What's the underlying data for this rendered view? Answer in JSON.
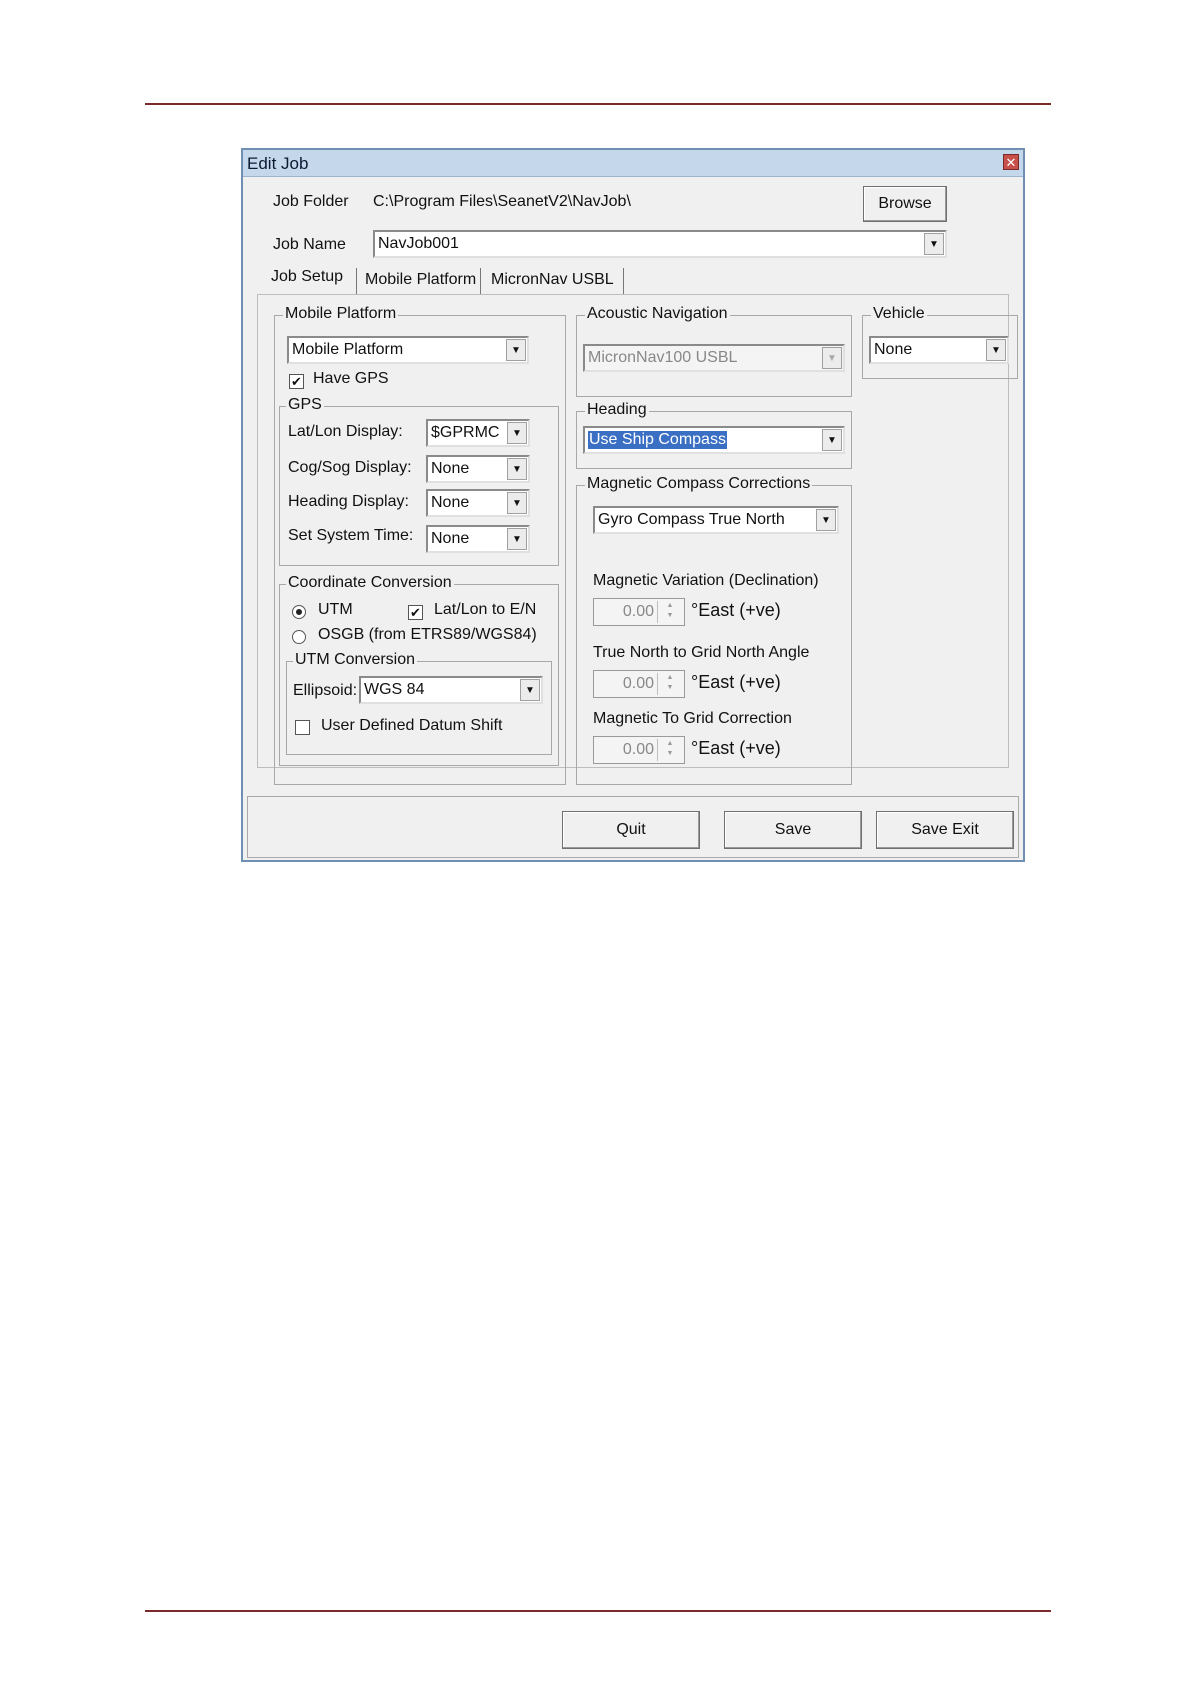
{
  "dialog": {
    "title": "Edit Job",
    "close_glyph": "✕"
  },
  "job": {
    "folder_label": "Job Folder",
    "folder_value": "C:\\Program Files\\SeanetV2\\NavJob\\",
    "browse_label": "Browse",
    "name_label": "Job Name",
    "name_value": "NavJob001"
  },
  "tabs": [
    {
      "label": "Job Setup",
      "selected": true
    },
    {
      "label": "Mobile Platform",
      "selected": false
    },
    {
      "label": "MicronNav USBL",
      "selected": false
    }
  ],
  "mobile_platform": {
    "caption": "Mobile Platform",
    "selected": "Mobile Platform",
    "have_gps_label": "Have GPS",
    "have_gps_checked": true
  },
  "gps": {
    "caption": "GPS",
    "rows": [
      {
        "label": "Lat/Lon Display:",
        "value": "$GPRMC"
      },
      {
        "label": "Cog/Sog Display:",
        "value": "None"
      },
      {
        "label": "Heading Display:",
        "value": "None"
      },
      {
        "label": "Set System Time:",
        "value": "None"
      }
    ]
  },
  "coord": {
    "caption": "Coordinate Conversion",
    "utm_label": "UTM",
    "utm_selected": true,
    "latlon_label": "Lat/Lon to E/N",
    "latlon_checked": true,
    "osgb_label": "OSGB (from ETRS89/WGS84)",
    "osgb_selected": false
  },
  "utm_conv": {
    "caption": "UTM Conversion",
    "ellipsoid_label": "Ellipsoid:",
    "ellipsoid_value": "WGS 84",
    "datum_label": "User Defined Datum Shift",
    "datum_checked": false
  },
  "acoustic": {
    "caption": "Acoustic Navigation",
    "value": "MicronNav100 USBL"
  },
  "heading": {
    "caption": "Heading",
    "value": "Use Ship Compass"
  },
  "magnetic": {
    "caption": "Magnetic Compass Corrections",
    "mode": "Gyro Compass True North",
    "fields": [
      {
        "label": "Magnetic Variation (Declination)",
        "value": "0.00",
        "unit": "°East (+ve)"
      },
      {
        "label": "True North to Grid North Angle",
        "value": "0.00",
        "unit": "°East (+ve)"
      },
      {
        "label": "Magnetic To Grid Correction",
        "value": "0.00",
        "unit": "°East (+ve)"
      }
    ]
  },
  "vehicle": {
    "caption": "Vehicle",
    "value": "None"
  },
  "buttons": {
    "quit": "Quit",
    "save": "Save",
    "save_exit": "Save Exit"
  },
  "icons": {
    "dropdown": "▼",
    "check": "✔",
    "spin_up": "▲",
    "spin_down": "▼"
  }
}
